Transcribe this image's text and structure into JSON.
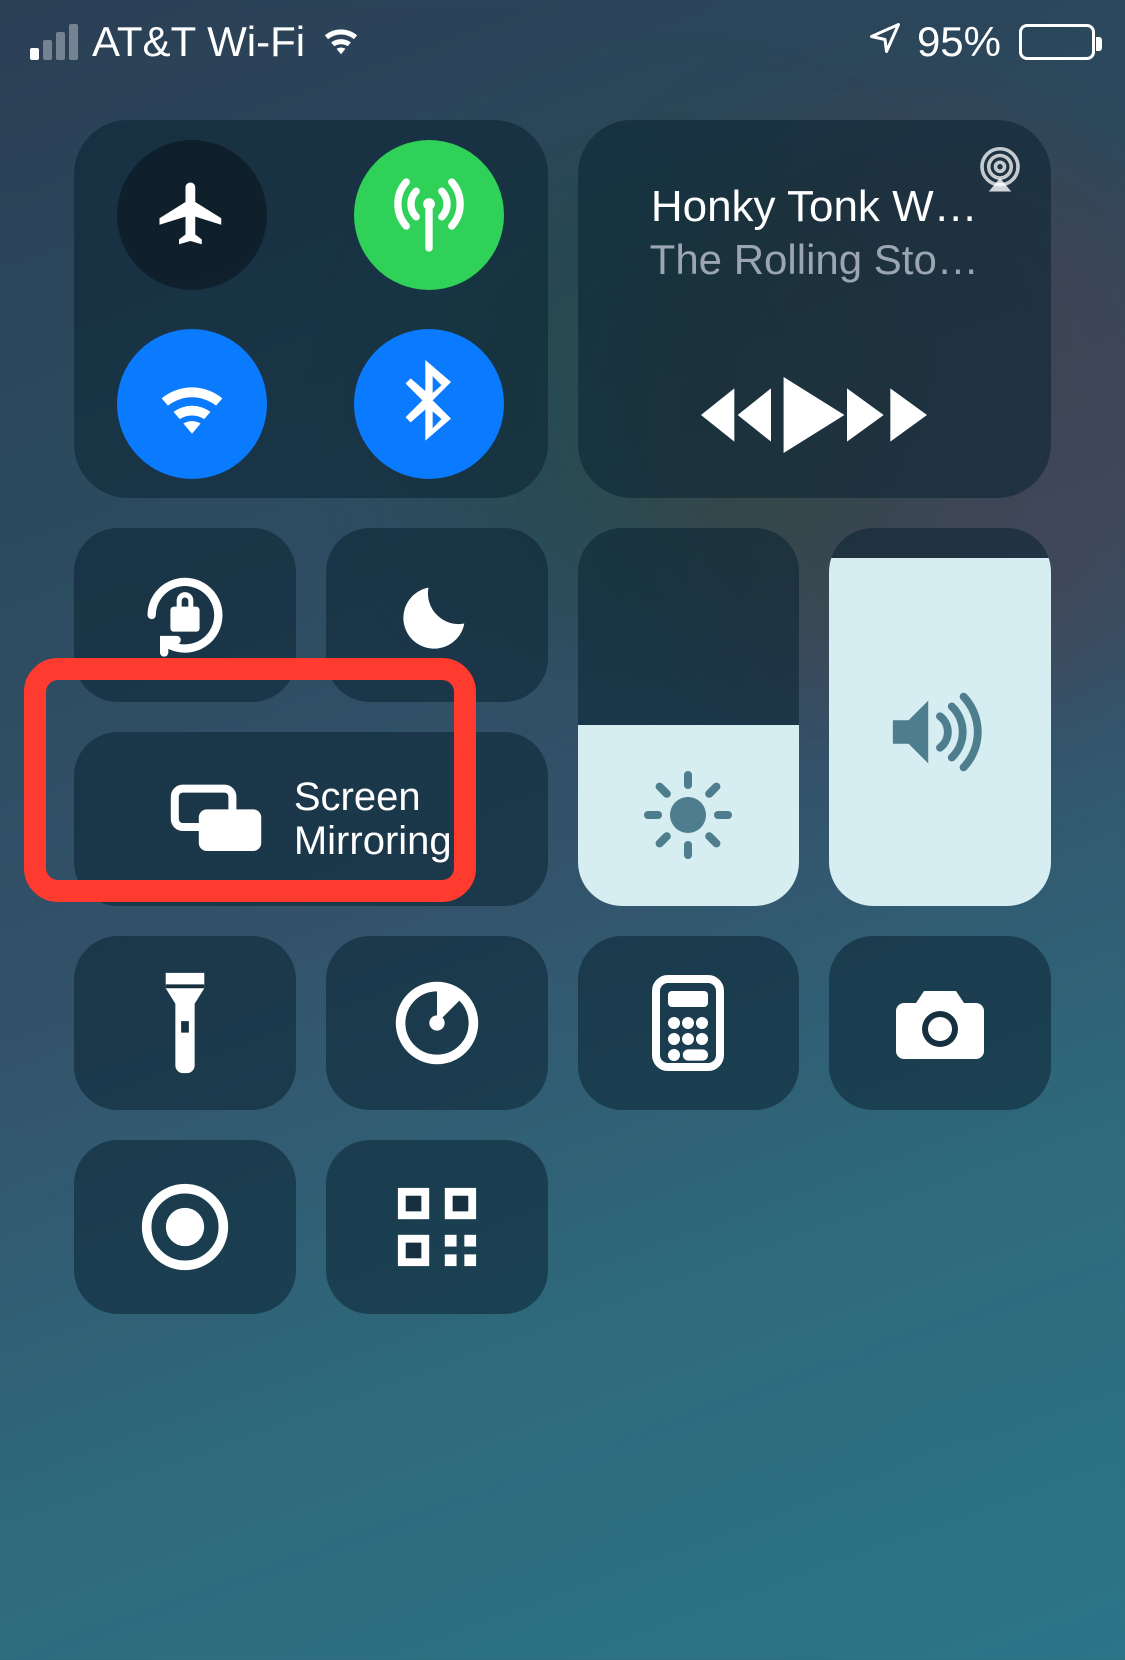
{
  "status_bar": {
    "carrier": "AT&T Wi-Fi",
    "battery_percent": "95%",
    "signal_strength_bars": 1,
    "wifi": true,
    "location_active": true
  },
  "connectivity": {
    "airplane_mode": {
      "active": false
    },
    "cellular_data": {
      "active": true,
      "color": "#2fd158"
    },
    "wifi": {
      "active": true,
      "color": "#0a7aff"
    },
    "bluetooth": {
      "active": true,
      "color": "#0a7aff"
    }
  },
  "media": {
    "title": "Honky Tonk W…",
    "artist": "The Rolling Sto…"
  },
  "toggles": {
    "orientation_lock": {
      "active": false
    },
    "do_not_disturb": {
      "active": false
    }
  },
  "screen_mirroring": {
    "label_line1": "Screen",
    "label_line2": "Mirroring"
  },
  "sliders": {
    "brightness": {
      "level_percent": 48
    },
    "volume": {
      "level_percent": 92
    }
  },
  "shortcuts": {
    "flashlight": true,
    "timer": true,
    "calculator": true,
    "camera": true,
    "screen_record": true,
    "qr_scanner": true
  },
  "annotation": {
    "highlight_target": "screen-mirroring-button",
    "highlight_color": "#ff3b30"
  }
}
